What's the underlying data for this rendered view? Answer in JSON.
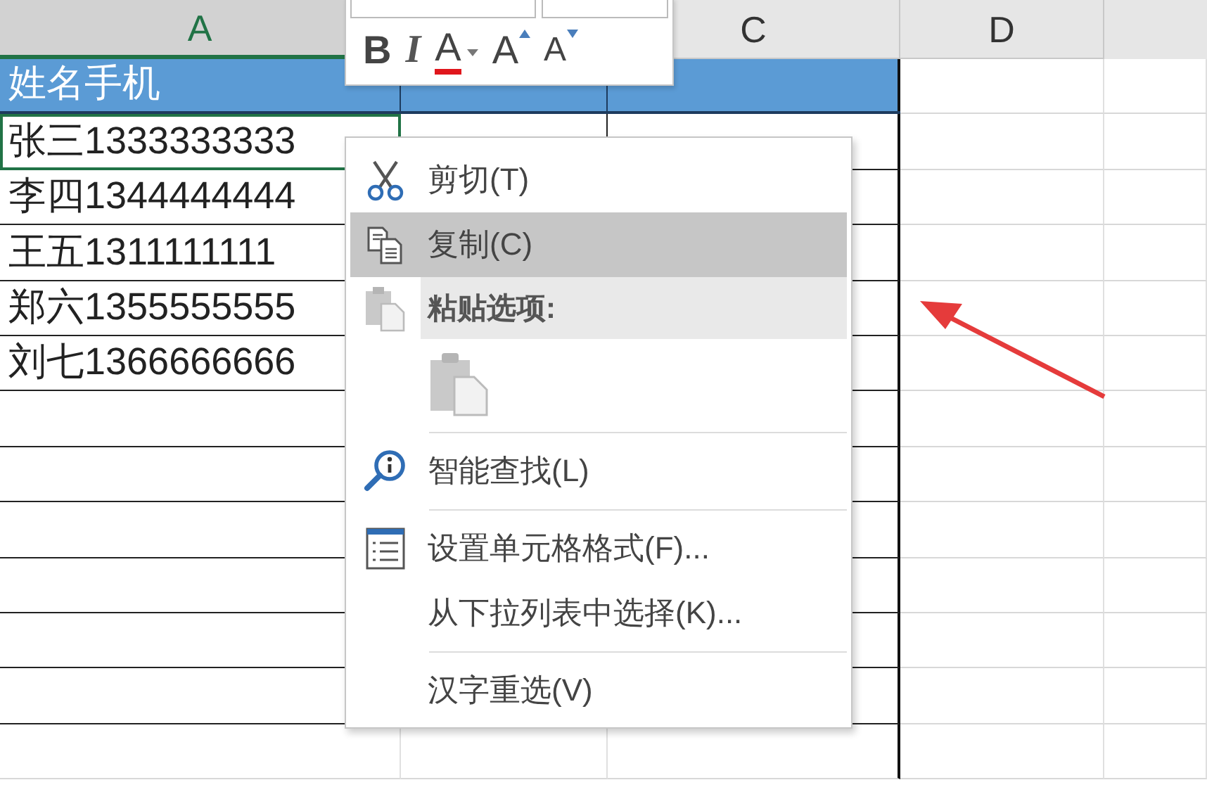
{
  "column_headers": [
    {
      "label": "A",
      "selected": true
    },
    {
      "label": "C",
      "selected": false
    },
    {
      "label": "D",
      "selected": false
    }
  ],
  "table": {
    "header": [
      "姓名手机"
    ],
    "rows": [
      {
        "a": "张三1333333333",
        "selected": true
      },
      {
        "a": "李四1344444444",
        "selected": false
      },
      {
        "a": "王五1311111111",
        "selected": false
      },
      {
        "a": "郑六1355555555",
        "selected": false
      },
      {
        "a": "刘七1366666666",
        "selected": false
      }
    ]
  },
  "mini_toolbar": {
    "buttons": [
      {
        "kind": "bold",
        "label": "B"
      },
      {
        "kind": "italic",
        "label": "I"
      },
      {
        "kind": "font_color",
        "label": "A"
      },
      {
        "kind": "grow",
        "label": "A"
      },
      {
        "kind": "shrink",
        "label": "A"
      }
    ]
  },
  "context_menu": {
    "items": [
      {
        "kind": "cut",
        "label": "剪切(T)",
        "selected": false
      },
      {
        "kind": "copy",
        "label": "复制(C)",
        "selected": true
      },
      {
        "kind": "paste_header",
        "label": "粘贴选项:"
      },
      {
        "kind": "paste_options"
      },
      {
        "kind": "separator"
      },
      {
        "kind": "lookup",
        "label": "智能查找(L)",
        "selected": false
      },
      {
        "kind": "separator"
      },
      {
        "kind": "format",
        "label": "设置单元格格式(F)...",
        "selected": false
      },
      {
        "kind": "plain",
        "label": "从下拉列表中选择(K)...",
        "selected": false
      },
      {
        "kind": "separator"
      },
      {
        "kind": "plain",
        "label": "汉字重选(V)",
        "selected": false
      }
    ]
  }
}
